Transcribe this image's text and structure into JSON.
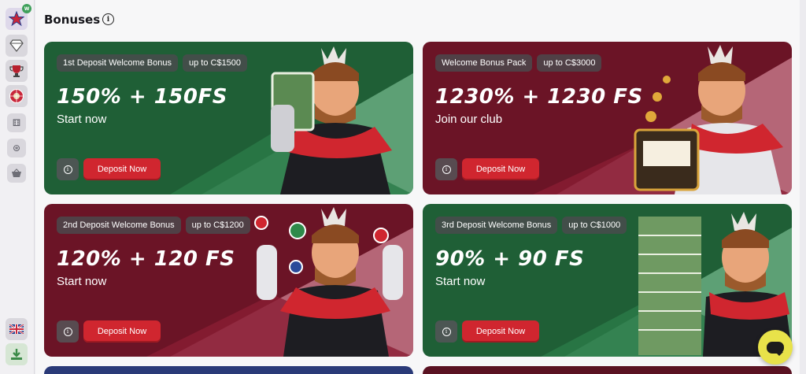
{
  "sidebar": {
    "badge": "W",
    "icons": [
      "star-logo-icon",
      "diamond-icon",
      "trophy-icon",
      "roulette-icon",
      "dice-icon",
      "chip-icon",
      "basket-icon",
      "uk-flag-icon",
      "download-icon"
    ]
  },
  "header": {
    "title": "Bonuses"
  },
  "cards": [
    {
      "chip1": "1st Deposit Welcome Bonus",
      "chip2": "up to C$1500",
      "headline": "150% + 150FS",
      "subline": "Start now",
      "button": "Deposit Now",
      "theme": "green"
    },
    {
      "chip1": "Welcome Bonus Pack",
      "chip2": "up to C$3000",
      "headline": "1230% + 1230 FS",
      "subline": "Join our club",
      "button": "Deposit Now",
      "theme": "maroon"
    },
    {
      "chip1": "2nd Deposit Welcome Bonus",
      "chip2": "up to C$1200",
      "headline": "120% + 120 FS",
      "subline": "Start now",
      "button": "Deposit Now",
      "theme": "maroon"
    },
    {
      "chip1": "3rd Deposit Welcome Bonus",
      "chip2": "up to C$1000",
      "headline": "90% + 90 FS",
      "subline": "Start now",
      "button": "Deposit Now",
      "theme": "green"
    }
  ],
  "colors": {
    "green": "#1f5f36",
    "maroon": "#6b1426",
    "button": "#d0262f",
    "chat": "#e8e24a"
  }
}
